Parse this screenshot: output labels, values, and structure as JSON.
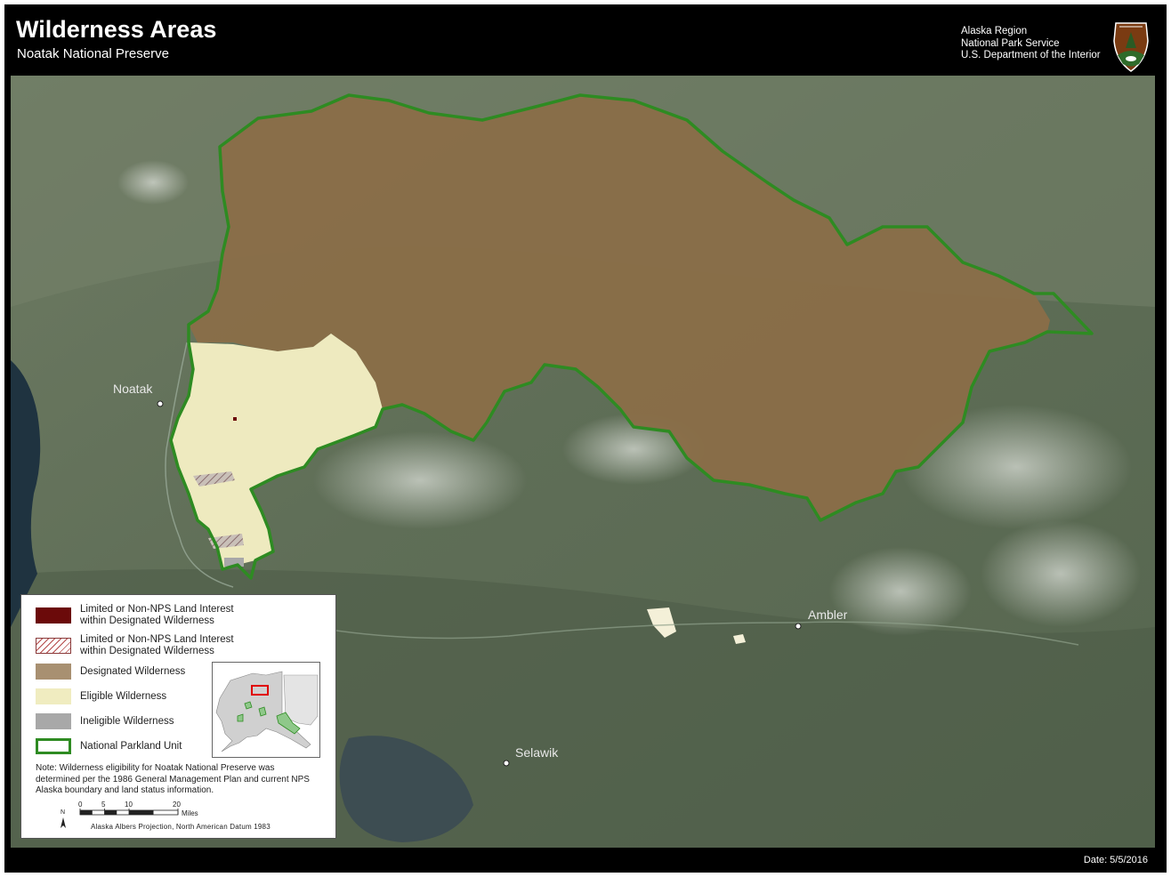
{
  "header": {
    "title": "Wilderness Areas",
    "subtitle": "Noatak National Preserve",
    "agency_lines": [
      "Alaska Region",
      "National Park Service",
      "U.S. Department of the Interior"
    ]
  },
  "map": {
    "towns": [
      {
        "name": "Noatak"
      },
      {
        "name": "Ambler"
      },
      {
        "name": "Selawik"
      }
    ]
  },
  "legend": {
    "items": [
      {
        "label": "Limited or Non-NPS Land Interest\nwithin Designated Wilderness",
        "color": "#6b0a0a",
        "style": "solid"
      },
      {
        "label": "Limited or Non-NPS Land Interest\nwithin Designated Wilderness",
        "color": "#b44a4a",
        "style": "hatch"
      },
      {
        "label": "Designated Wilderness",
        "color": "#a89071",
        "style": "solid"
      },
      {
        "label": "Eligible Wilderness",
        "color": "#f0ecc0",
        "style": "solid"
      },
      {
        "label": "Ineligible Wilderness",
        "color": "#a8a8a8",
        "style": "solid"
      },
      {
        "label": "National Parkland Unit",
        "color": "#2e8b22",
        "style": "outline"
      }
    ],
    "note": "Note: Wilderness eligibility for Noatak National Preserve was determined per the 1986 General Management Plan and current NPS Alaska boundary and land status information.",
    "scale": {
      "ticks": [
        "0",
        "5",
        "10",
        "20"
      ],
      "unit": "Miles",
      "north": "N"
    },
    "projection": "Alaska Albers Projection, North American Datum 1983"
  },
  "footer": {
    "date": "Date: 5/5/2016"
  },
  "colors": {
    "designated": "#8a6e48",
    "eligible": "#eeeabf",
    "boundary": "#2e8b22",
    "terrain": "#5b6a55",
    "water": "#1f3340"
  }
}
